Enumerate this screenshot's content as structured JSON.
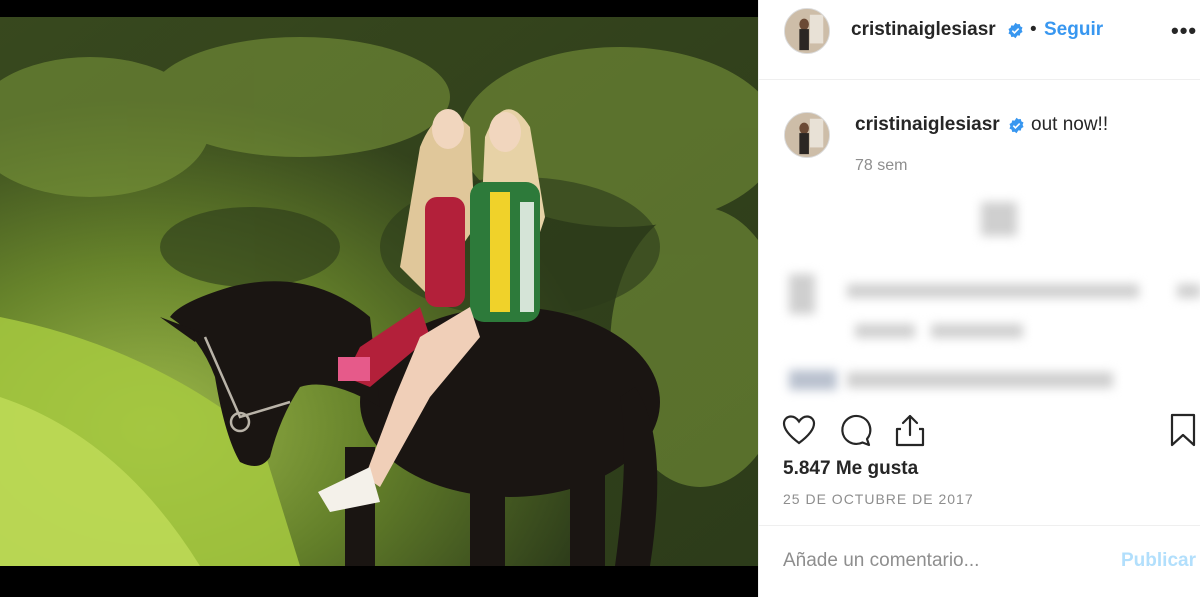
{
  "post": {
    "image_alt": "Two blonde girls in colorful dresses riding a dark horse in a green forest"
  },
  "header": {
    "username": "cristinaiglesiasr",
    "dot": "•",
    "follow_label": "Seguir",
    "more_label": "•••"
  },
  "caption": {
    "username": "cristinaiglesiasr",
    "text": "out now!!",
    "time": "78 sem"
  },
  "actions": {
    "like_icon": "heart-icon",
    "comment_icon": "comment-icon",
    "share_icon": "share-icon",
    "save_icon": "bookmark-icon"
  },
  "stats": {
    "likes": "5.847 Me gusta",
    "date": "25 DE OCTUBRE DE 2017"
  },
  "comment_box": {
    "placeholder": "Añade un comentario...",
    "publish_label": "Publicar"
  },
  "colors": {
    "accent": "#3897f0",
    "publish_disabled": "#b2dffc",
    "verified": "#3897f0",
    "text": "#262626",
    "muted": "#8e8e8e"
  }
}
